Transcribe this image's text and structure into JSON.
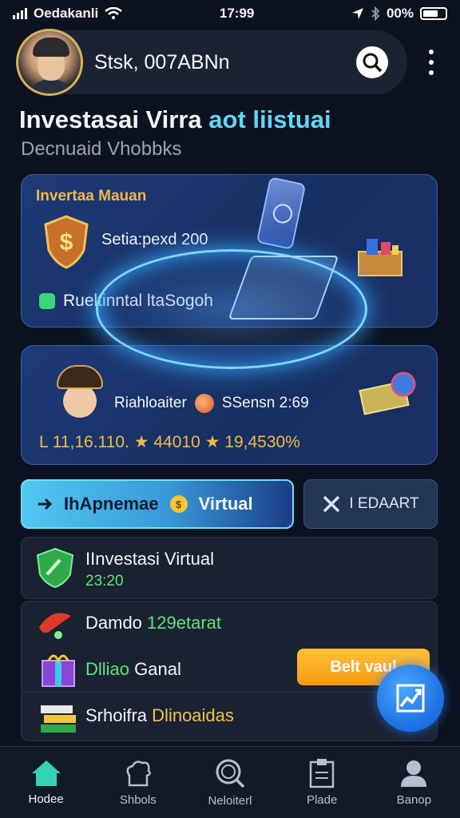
{
  "status_bar": {
    "carrier": "Oedakanli",
    "time": "17:99",
    "battery": "00%"
  },
  "header": {
    "title": "Stsk, 007ABNn"
  },
  "page": {
    "title_main": "Investasai Virra",
    "title_accent": "aot liistuai",
    "subtitle": "Decnuaid Vhobbks"
  },
  "card1": {
    "label": "Invertaa Mauan",
    "stat": "Setia:pexd 200",
    "line": "Rueltinntal ltaSogoh"
  },
  "card2": {
    "row_left": "Riahloaiter",
    "row_right": "SSensn 2:69",
    "values": "L 11,16.110. ★ 44010 ★ 19,4530%"
  },
  "buttons": {
    "primary_label": "IhApnemae",
    "primary_accent": "Virtual",
    "coin_symbol": "$",
    "secondary_label": "I EDAART"
  },
  "list": {
    "item1_title": "IInvestasi Virtual",
    "item1_value": "23:20",
    "item2_label": "Damdo",
    "item2_value": "129etarat",
    "item3_label_green": "Dlliao",
    "item3_label": "Ganal",
    "item4_label": "Srhoifra",
    "item4_accent": "Dlinoaidas",
    "action_button": "Belt vaul"
  },
  "nav": {
    "items": [
      {
        "label": "Hodee",
        "icon": "home-icon"
      },
      {
        "label": "Shbols",
        "icon": "chef-hat-icon"
      },
      {
        "label": "Neloiterl",
        "icon": "search-icon"
      },
      {
        "label": "Plade",
        "icon": "clipboard-icon"
      },
      {
        "label": "Banop",
        "icon": "profile-icon"
      }
    ],
    "active_index": 0
  },
  "colors": {
    "accent_cyan": "#64d6f3",
    "gold": "#f2b84a",
    "green": "#61e17a",
    "orange": "#f69a12",
    "background": "#0c1220"
  }
}
